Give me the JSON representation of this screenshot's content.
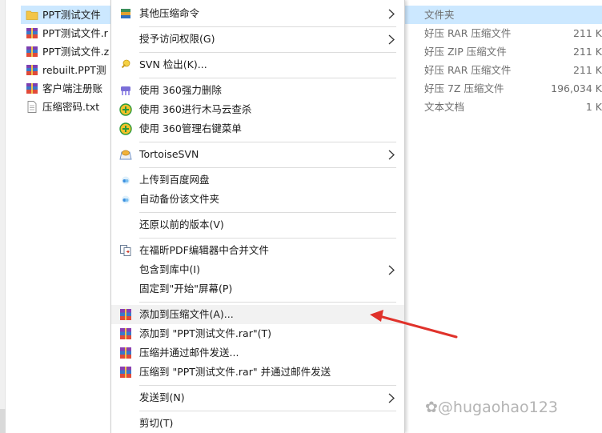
{
  "files": [
    {
      "name": "PPT测试文件",
      "icon": "folder-icon",
      "selected": true
    },
    {
      "name": "PPT测试文件.r",
      "icon": "winrar-archive-icon"
    },
    {
      "name": "PPT测试文件.z",
      "icon": "winrar-archive-icon"
    },
    {
      "name": "rebuilt.PPT测",
      "icon": "winrar-archive-icon"
    },
    {
      "name": "客户端注册账",
      "icon": "winrar-archive-icon"
    },
    {
      "name": "压缩密码.txt",
      "icon": "text-file-icon"
    }
  ],
  "details": [
    {
      "type": "文件夹",
      "size": ""
    },
    {
      "type": "好压 RAR 压缩文件",
      "size": "211 K"
    },
    {
      "type": "好压 ZIP 压缩文件",
      "size": "211 K"
    },
    {
      "type": "好压 RAR 压缩文件",
      "size": "211 K"
    },
    {
      "type": "好压 7Z 压缩文件",
      "size": "196,034 K"
    },
    {
      "type": "文本文档",
      "size": "1 K"
    }
  ],
  "menu": {
    "items": [
      {
        "label": "其他压缩命令",
        "icon": "haozip-icon",
        "submenu": true
      },
      {
        "label": "授予访问权限(G)",
        "icon": "",
        "submenu": true
      },
      {
        "label": "SVN 检出(K)...",
        "icon": "svn-checkout-icon"
      },
      {
        "label": "使用 360强力删除",
        "icon": "360-shred-icon"
      },
      {
        "label": "使用 360进行木马云查杀",
        "icon": "360-scan-icon"
      },
      {
        "label": "使用 360管理右键菜单",
        "icon": "360-menu-icon"
      },
      {
        "label": "TortoiseSVN",
        "icon": "tortoisesvn-icon",
        "submenu": true
      },
      {
        "label": "上传到百度网盘",
        "icon": "baidu-cloud-icon"
      },
      {
        "label": "自动备份该文件夹",
        "icon": "baidu-backup-icon"
      },
      {
        "label": "还原以前的版本(V)",
        "icon": ""
      },
      {
        "label": "在福昕PDF编辑器中合并文件",
        "icon": "foxit-merge-icon"
      },
      {
        "label": "包含到库中(I)",
        "icon": "",
        "submenu": true
      },
      {
        "label": "固定到\"开始\"屏幕(P)",
        "icon": ""
      },
      {
        "label": "添加到压缩文件(A)...",
        "icon": "winrar-icon",
        "highlighted": true
      },
      {
        "label": "添加到 \"PPT测试文件.rar\"(T)",
        "icon": "winrar-icon"
      },
      {
        "label": "压缩并通过邮件发送...",
        "icon": "winrar-icon"
      },
      {
        "label": "压缩到 \"PPT测试文件.rar\" 并通过邮件发送",
        "icon": "winrar-icon"
      },
      {
        "label": "发送到(N)",
        "icon": "",
        "submenu": true
      },
      {
        "label": "剪切(T)",
        "icon": ""
      }
    ]
  },
  "annotation": {
    "arrow_color": "#e0322b"
  },
  "watermark": "@hugaohao123"
}
